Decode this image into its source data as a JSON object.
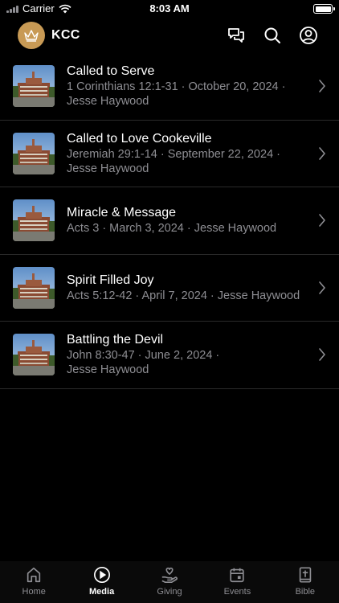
{
  "status": {
    "carrier": "Carrier",
    "time": "8:03 AM"
  },
  "header": {
    "title": "KCC"
  },
  "sermons": [
    {
      "title": "Called to Serve",
      "line1": "1 Corinthians 12:1-31 · October 20, 2024 ·",
      "line2": "Jesse Haywood"
    },
    {
      "title": "Called to Love Cookeville",
      "line1": "Jeremiah 29:1-14 · September 22, 2024 ·",
      "line2": "Jesse Haywood"
    },
    {
      "title": "Miracle & Message",
      "line1": "Acts 3 · March 3, 2024 · Jesse Haywood",
      "line2": ""
    },
    {
      "title": "Spirit Filled Joy",
      "line1": "Acts 5:12-42 · April 7, 2024 · Jesse Haywood",
      "line2": ""
    },
    {
      "title": "Battling the Devil",
      "line1": "John 8:30-47 · June 2, 2024 ·",
      "line2": "Jesse Haywood"
    }
  ],
  "tabs": [
    {
      "label": "Home",
      "icon": "home-icon",
      "active": false
    },
    {
      "label": "Media",
      "icon": "play-circle-icon",
      "active": true
    },
    {
      "label": "Giving",
      "icon": "giving-hand-icon",
      "active": false
    },
    {
      "label": "Events",
      "icon": "calendar-icon",
      "active": false
    },
    {
      "label": "Bible",
      "icon": "bible-icon",
      "active": false
    }
  ],
  "colors": {
    "accent": "#c89a55",
    "background": "#000000",
    "secondary_text": "#8e8e93"
  }
}
